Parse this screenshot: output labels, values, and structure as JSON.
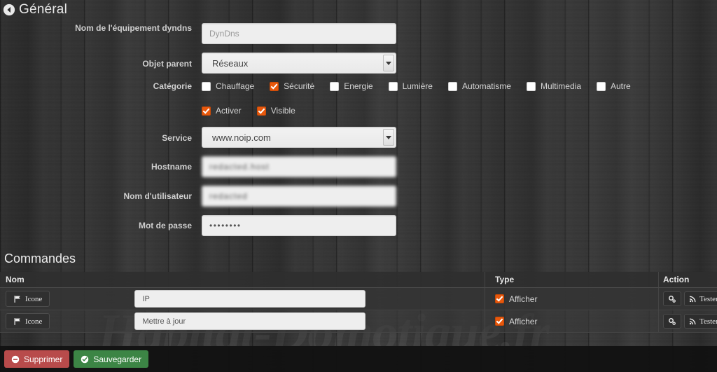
{
  "header": {
    "back_icon": "back-arrow-circle-icon",
    "title": "Général"
  },
  "general_form": {
    "fields": [
      {
        "label": "Nom de l'équipement dyndns",
        "type": "text",
        "value": "",
        "placeholder": "DynDns"
      },
      {
        "label": "Objet parent",
        "type": "select",
        "value": "Réseaux"
      },
      {
        "label": "Catégorie",
        "type": "checkbox-group"
      },
      {
        "label": "Service",
        "type": "select",
        "value": "www.noip.com"
      },
      {
        "label": "Hostname",
        "type": "text",
        "value": "redacted.host",
        "placeholder": ""
      },
      {
        "label": "Nom d'utilisateur",
        "type": "text",
        "value": "redacted",
        "placeholder": ""
      },
      {
        "label": "Mot de passe",
        "type": "password",
        "value": "••••••••",
        "placeholder": ""
      }
    ],
    "categories": [
      {
        "label": "Chauffage",
        "checked": false
      },
      {
        "label": "Sécurité",
        "checked": true
      },
      {
        "label": "Energie",
        "checked": false
      },
      {
        "label": "Lumière",
        "checked": false
      },
      {
        "label": "Automatisme",
        "checked": false
      },
      {
        "label": "Multimedia",
        "checked": false
      },
      {
        "label": "Autre",
        "checked": false
      }
    ],
    "flags": [
      {
        "label": "Activer",
        "checked": true
      },
      {
        "label": "Visible",
        "checked": true
      }
    ]
  },
  "commandes": {
    "title": "Commandes",
    "columns": {
      "nom": "Nom",
      "type": "Type",
      "action": "Action"
    },
    "rows": [
      {
        "icon_button_label": "Icone",
        "icon_button_icon": "flag-icon",
        "name_value": "IP",
        "type_label": "Afficher",
        "type_checked": true,
        "config_icon": "cogs-icon",
        "test_label": "Tester",
        "test_icon": "signal-rss-icon"
      },
      {
        "icon_button_label": "Icone",
        "icon_button_icon": "flag-icon",
        "name_value": "Mettre à jour",
        "type_label": "Afficher",
        "type_checked": true,
        "config_icon": "cogs-icon",
        "test_label": "Tester",
        "test_icon": "signal-rss-icon"
      }
    ]
  },
  "footer": {
    "delete_label": "Supprimer",
    "delete_icon": "minus-circle-icon",
    "save_label": "Sauvegarder",
    "save_icon": "check-circle-icon"
  },
  "watermark": {
    "text": "Habitat-Domotique.fr"
  },
  "colors": {
    "accent": "#e8580c",
    "delete": "#b84b4b",
    "save": "#3c8545",
    "background": "#333333",
    "text": "#dcdcdc"
  }
}
